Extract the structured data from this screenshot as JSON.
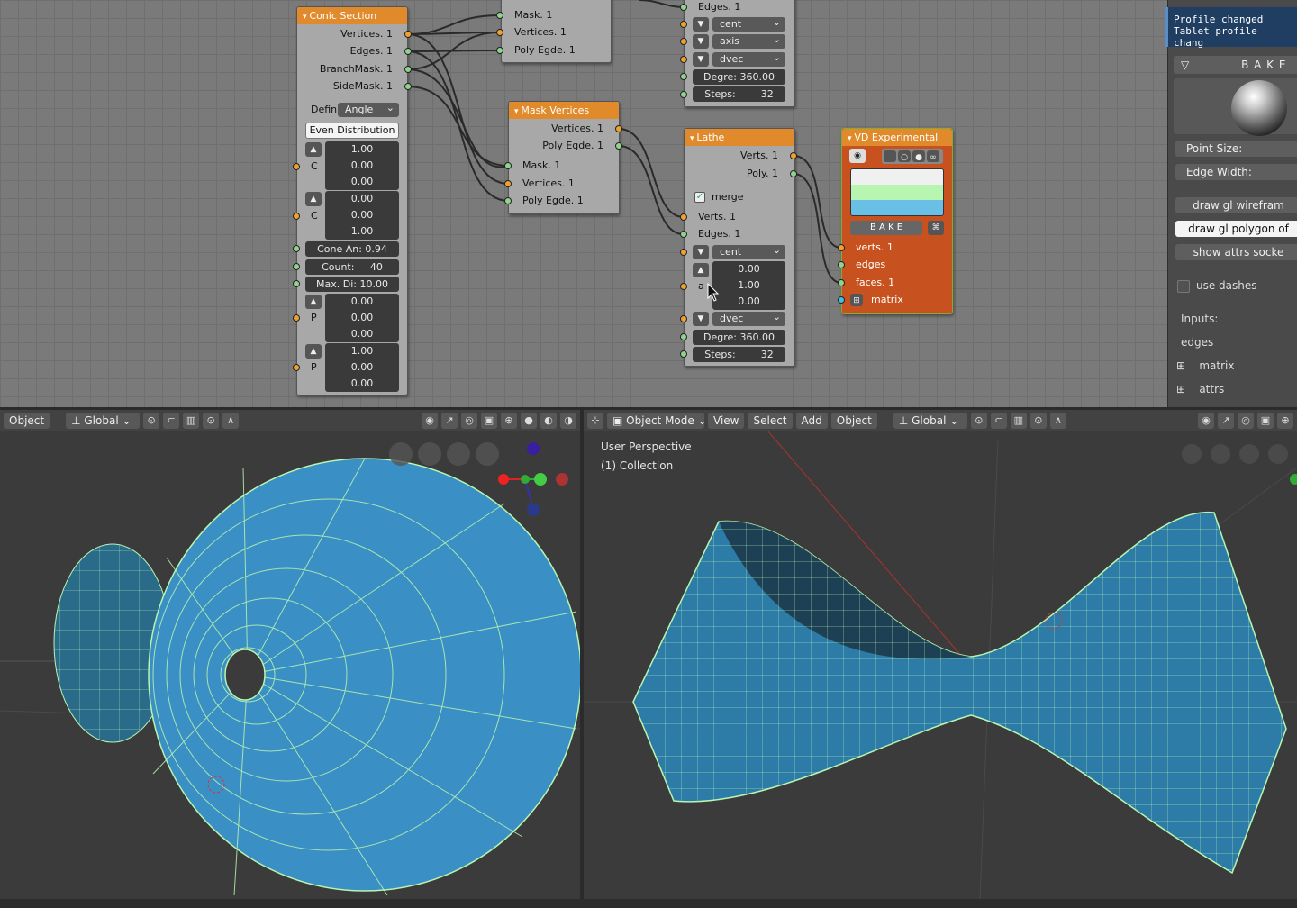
{
  "toast": {
    "line1": "Profile changed",
    "line2": "Tablet profile chang"
  },
  "nodes": {
    "conic": {
      "title": "Conic Section",
      "outputs": [
        "Vertices. 1",
        "Edges. 1",
        "BranchMask. 1",
        "SideMask. 1"
      ],
      "defin_label": "Defin",
      "defin_value": "Angle",
      "even_dist": "Even Distribution",
      "v1": [
        "1.00",
        "0.00",
        "0.00"
      ],
      "c1": "C",
      "v2": [
        "0.00",
        "0.00",
        "1.00"
      ],
      "c2": "C",
      "cone_angle": "Cone An: 0.94",
      "count_label": "Count:",
      "count_value": "40",
      "max_dist": "Max. Di: 10.00",
      "p1": [
        "0.00",
        "0.00",
        "0.00"
      ],
      "p1_label": "P",
      "p2": [
        "1.00",
        "0.00",
        "0.00"
      ],
      "p2_label": "P"
    },
    "mask_top": {
      "inputs": [
        "Mask. 1",
        "Vertices. 1",
        "Poly Egde. 1"
      ]
    },
    "mask_vertices": {
      "title": "Mask Vertices",
      "outputs": [
        "Vertices. 1",
        "Poly Egde. 1"
      ],
      "inputs": [
        "Mask. 1",
        "Vertices. 1",
        "Poly Egde. 1"
      ]
    },
    "lathe_top": {
      "edges": "Edges. 1",
      "dd1": "cent",
      "dd2": "axis",
      "dd3": "dvec",
      "degree": "Degre: 360.00",
      "steps_label": "Steps:",
      "steps": "32"
    },
    "lathe": {
      "title": "Lathe",
      "outputs": [
        "Verts. 1",
        "Poly. 1"
      ],
      "merge": "merge",
      "inputs": [
        "Verts. 1",
        "Edges. 1"
      ],
      "dd1": "cent",
      "axis_vals": [
        "0.00",
        "1.00",
        "0.00"
      ],
      "axis_label": "a",
      "dd2": "dvec",
      "degree": "Degre: 360.00",
      "steps_label": "Steps:",
      "steps": "32"
    },
    "vd": {
      "title": "VD Experimental",
      "bake": "B A K E",
      "inputs": [
        "verts. 1",
        "edges",
        "faces. 1",
        "matrix"
      ]
    }
  },
  "side_panel": {
    "bake": "B A K E",
    "point_size": "Point Size:",
    "edge_width": "Edge Width:",
    "btn1": "draw gl wirefram",
    "btn2": "draw gl polygon of",
    "btn3": "show attrs socke",
    "use_dashes": "use dashes",
    "inputs_label": "Inputs:",
    "edges": "edges",
    "matrix": "matrix",
    "attrs": "attrs"
  },
  "viewport_left": {
    "mode": "Object",
    "orientation": "Global"
  },
  "viewport_right": {
    "mode": "Object Mode",
    "menu": [
      "View",
      "Select",
      "Add",
      "Object"
    ],
    "orientation": "Global",
    "perspective": "User Perspective",
    "collection": "(1) Collection"
  },
  "colors": {
    "accent": "#e08a2c",
    "mesh": "#3a8fc4",
    "wire": "#b8f5b0"
  }
}
